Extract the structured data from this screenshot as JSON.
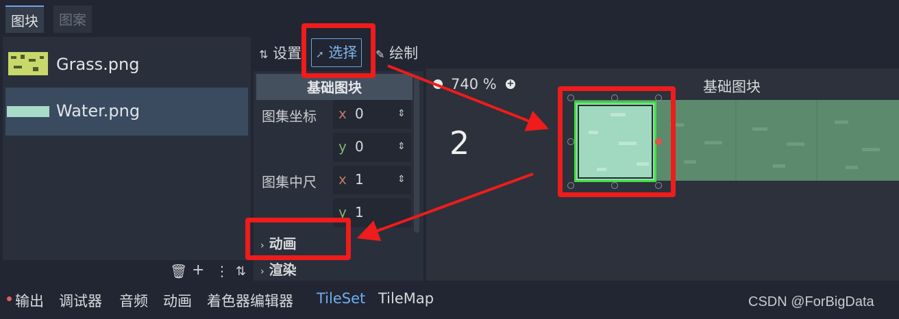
{
  "top_tabs": [
    "图块",
    "图案"
  ],
  "files": [
    "Grass.png",
    "Water.png"
  ],
  "mode_tabs": {
    "settings": "设置",
    "select": "选择",
    "paint": "绘制"
  },
  "inspector": {
    "header": "基础图块",
    "atlas_coords_label": "图集坐标",
    "atlas_coords": {
      "x": "0",
      "y": "0"
    },
    "atlas_size_label": "图集中尺",
    "atlas_size": {
      "x": "1",
      "y": "1"
    },
    "axis_x": "x",
    "axis_y": "y",
    "sections": [
      "动画",
      "渲染"
    ]
  },
  "viewport": {
    "zoom": "740 %",
    "title": "基础图块",
    "annotation_number": "2"
  },
  "bottom_tabs": [
    "输出",
    "调试器",
    "音频",
    "动画",
    "着色器编辑器",
    "TileSet",
    "TileMap"
  ],
  "watermark": "CSDN @ForBigData",
  "colors": {
    "accent": "#6ea6e6",
    "annotation": "#ee1c1c",
    "selection": "#3fe03f"
  }
}
